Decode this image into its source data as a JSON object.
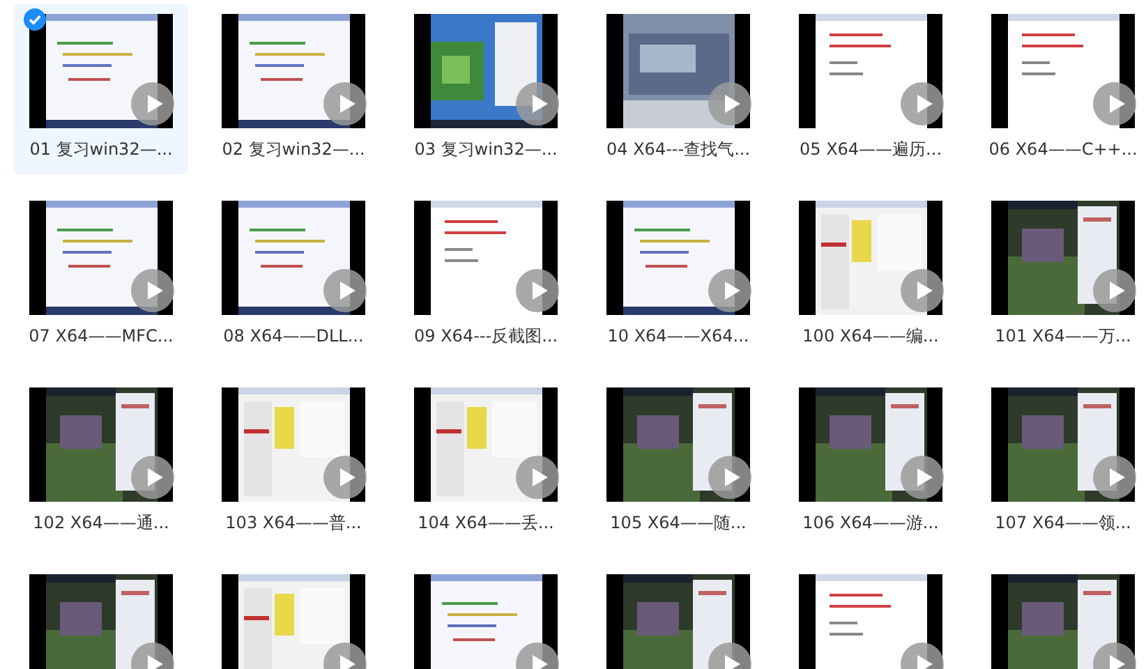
{
  "items": [
    {
      "label": "01 复习win32—...",
      "selected": true
    },
    {
      "label": "02 复习win32—...",
      "selected": false
    },
    {
      "label": "03 复习win32—...",
      "selected": false
    },
    {
      "label": "04 X64---查找气...",
      "selected": false
    },
    {
      "label": "05 X64——遍历...",
      "selected": false
    },
    {
      "label": "06 X64——C++...",
      "selected": false
    },
    {
      "label": "07 X64——MFC...",
      "selected": false
    },
    {
      "label": "08 X64——DLL...",
      "selected": false
    },
    {
      "label": "09 X64---反截图...",
      "selected": false
    },
    {
      "label": "10 X64——X64...",
      "selected": false
    },
    {
      "label": "100 X64——编...",
      "selected": false
    },
    {
      "label": "101 X64——万...",
      "selected": false
    },
    {
      "label": "102 X64——通...",
      "selected": false
    },
    {
      "label": "103 X64——普...",
      "selected": false
    },
    {
      "label": "104 X64——丢...",
      "selected": false
    },
    {
      "label": "105 X64——随...",
      "selected": false
    },
    {
      "label": "106 X64——游...",
      "selected": false
    },
    {
      "label": "107 X64——领...",
      "selected": false
    },
    {
      "selected": false
    },
    {
      "selected": false
    },
    {
      "selected": false
    },
    {
      "selected": false
    },
    {
      "selected": false
    },
    {
      "selected": false
    }
  ]
}
